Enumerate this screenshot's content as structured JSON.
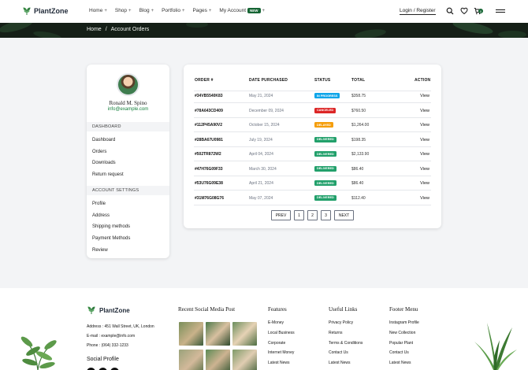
{
  "header": {
    "logo_text": "PlantZone",
    "nav": [
      {
        "label": "Home"
      },
      {
        "label": "Shop"
      },
      {
        "label": "Blog"
      },
      {
        "label": "Portfolio"
      },
      {
        "label": "Pages"
      },
      {
        "label": "My Account",
        "badge": "NEW"
      }
    ],
    "login_label": "Login / Register",
    "cart_count": "0",
    "icons": [
      "search-icon",
      "heart-icon",
      "cart-icon",
      "menu-icon"
    ]
  },
  "breadcrumb": {
    "home": "Home",
    "separator": "/",
    "current": "Account Orders"
  },
  "sidebar": {
    "name": "Ronald M. Spino",
    "email": "info@example.com",
    "dashboard_title": "DASHBOARD",
    "dashboard_links": [
      "Dashboard",
      "Orders",
      "Downloads",
      "Return request"
    ],
    "settings_title": "ACCOUNT SETTINGS",
    "settings_links": [
      "Profile",
      "Address",
      "Shipping methods",
      "Payment Methods",
      "Review"
    ]
  },
  "orders": {
    "columns": [
      "ORDER #",
      "DATE PURCHASED",
      "STATUS",
      "TOTAL",
      "ACTION"
    ],
    "rows": [
      {
        "id": "#34VB5540K83",
        "date": "May 21, 2024",
        "status": "IN PROGRESS",
        "status_color": "#0ea5e9",
        "total": "$358.75",
        "action": "View"
      },
      {
        "id": "#78A643CD409",
        "date": "December 09, 2024",
        "status": "CANCELED",
        "status_color": "#dc2626",
        "total": "$760.50",
        "action": "View"
      },
      {
        "id": "#112P45A90V2",
        "date": "October 15, 2024",
        "status": "DELAYED",
        "status_color": "#f59e0b",
        "total": "$1,264.00",
        "action": "View"
      },
      {
        "id": "#28BA67U0981",
        "date": "July 19, 2024",
        "status": "DELIVERED",
        "status_color": "#22a06b",
        "total": "$198.35",
        "action": "View"
      },
      {
        "id": "#502TR872W2",
        "date": "April 04, 2024",
        "status": "DELIVERED",
        "status_color": "#22a06b",
        "total": "$2,133.90",
        "action": "View"
      },
      {
        "id": "#47H76G09F33",
        "date": "March 30, 2024",
        "status": "DELIVERED",
        "status_color": "#22a06b",
        "total": "$86.40",
        "action": "View"
      },
      {
        "id": "#53U76G09E38",
        "date": "April 21, 2024",
        "status": "DELIVERED",
        "status_color": "#22a06b",
        "total": "$86.40",
        "action": "View"
      },
      {
        "id": "#31M76G08G76",
        "date": "May 07, 2024",
        "status": "DELIVERED",
        "status_color": "#22a06b",
        "total": "$112.40",
        "action": "View"
      }
    ],
    "pagination": {
      "prev": "PREV",
      "pages": [
        "1",
        "2",
        "3"
      ],
      "next": "NEXT"
    }
  },
  "footer": {
    "logo_text": "PlantZone",
    "address": "Address : 451 Wall Street, UK, London",
    "email": "E-mail : example@info.com",
    "phone": "Phone : (064) 332-1233",
    "social_title": "Social Profile",
    "social_post_title": "Recent Social Media Post",
    "features_title": "Features",
    "features": [
      "E-Money",
      "Local Business",
      "Corporate",
      "Internet Money",
      "Latest News"
    ],
    "useful_title": "Useful Links",
    "useful": [
      "Privacy Policy",
      "Returns",
      "Terms & Conditions",
      "Contact Us",
      "Latest News"
    ],
    "menu_title": "Footer Menu",
    "menu": [
      "Instagram Profile",
      "New Collection",
      "Popular Plant",
      "Contact Us",
      "Latest News"
    ]
  },
  "colors": {
    "brand_green": "#166534",
    "banner_bg": "#151f17",
    "page_bg": "#f3f4f6"
  }
}
